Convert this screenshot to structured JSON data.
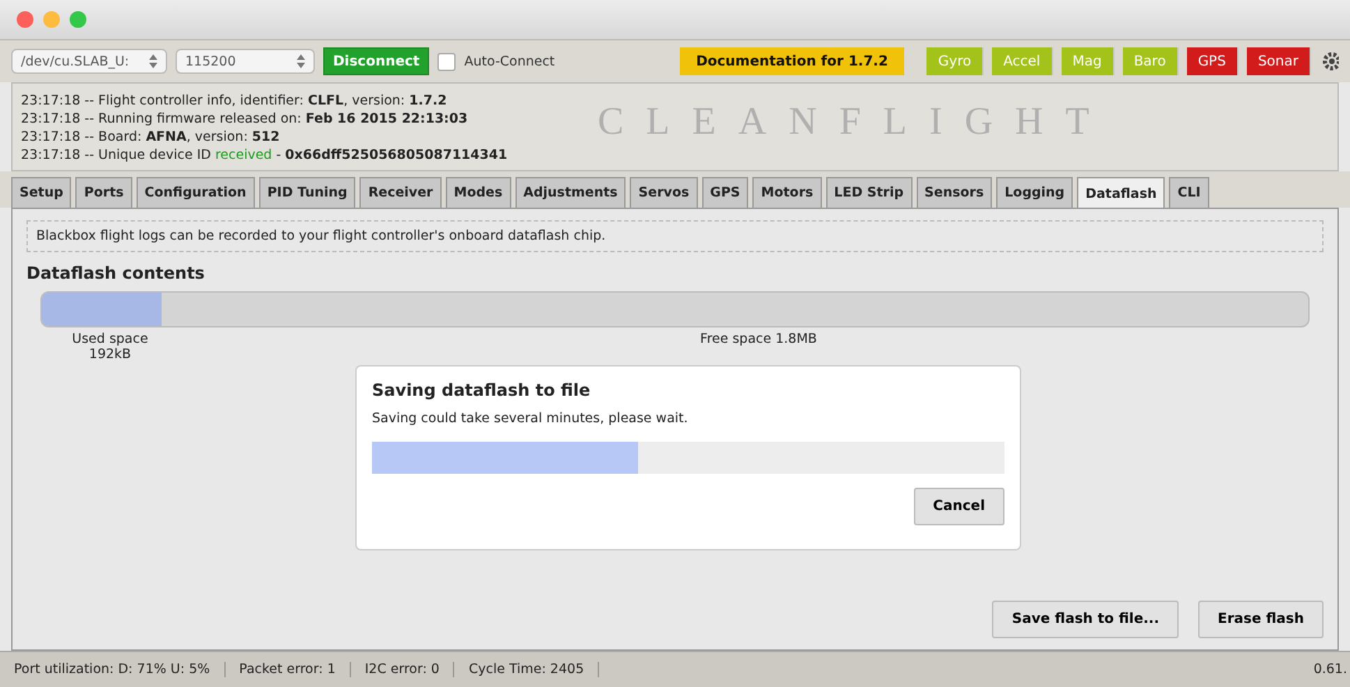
{
  "toolbar": {
    "port": {
      "value": "/dev/cu.SLAB_U:"
    },
    "baud": {
      "value": "115200"
    },
    "connect_button": "Disconnect",
    "auto_connect": {
      "label": "Auto-Connect",
      "checked": false
    },
    "docs_button": "Documentation for 1.7.2",
    "sensors": [
      {
        "label": "Gyro",
        "color": "#a3c21a"
      },
      {
        "label": "Accel",
        "color": "#a3c21a"
      },
      {
        "label": "Mag",
        "color": "#a3c21a"
      },
      {
        "label": "Baro",
        "color": "#a3c21a"
      },
      {
        "label": "GPS",
        "color": "#d21b1b"
      },
      {
        "label": "Sonar",
        "color": "#d21b1b"
      }
    ]
  },
  "log": {
    "logo_text": "CLEANFLIGHT",
    "lines": [
      [
        {
          "kind": "plain",
          "text": "23:17:18 -- Flight controller info, identifier: "
        },
        {
          "kind": "bold",
          "text": "CLFL"
        },
        {
          "kind": "plain",
          "text": ", version: "
        },
        {
          "kind": "bold",
          "text": "1.7.2"
        }
      ],
      [
        {
          "kind": "plain",
          "text": "23:17:18 -- Running firmware released on: "
        },
        {
          "kind": "bold",
          "text": "Feb 16 2015 22:13:03"
        }
      ],
      [
        {
          "kind": "plain",
          "text": "23:17:18 -- Board: "
        },
        {
          "kind": "bold",
          "text": "AFNA"
        },
        {
          "kind": "plain",
          "text": ", version: "
        },
        {
          "kind": "bold",
          "text": "512"
        }
      ],
      [
        {
          "kind": "plain",
          "text": "23:17:18 -- Unique device ID "
        },
        {
          "kind": "ok",
          "text": "received"
        },
        {
          "kind": "plain",
          "text": " - "
        },
        {
          "kind": "bold",
          "text": "0x66dff525056805087114341"
        }
      ]
    ]
  },
  "tabs": [
    {
      "label": "Setup",
      "selected": false
    },
    {
      "label": "Ports",
      "selected": false
    },
    {
      "label": "Configuration",
      "selected": false
    },
    {
      "label": "PID Tuning",
      "selected": false
    },
    {
      "label": "Receiver",
      "selected": false
    },
    {
      "label": "Modes",
      "selected": false
    },
    {
      "label": "Adjustments",
      "selected": false
    },
    {
      "label": "Servos",
      "selected": false
    },
    {
      "label": "GPS",
      "selected": false
    },
    {
      "label": "Motors",
      "selected": false
    },
    {
      "label": "LED Strip",
      "selected": false
    },
    {
      "label": "Sensors",
      "selected": false
    },
    {
      "label": "Logging",
      "selected": false
    },
    {
      "label": "Dataflash",
      "selected": true
    },
    {
      "label": "CLI",
      "selected": false
    }
  ],
  "dataflash": {
    "note": "Blackbox flight logs can be recorded to your flight controller's onboard dataflash chip.",
    "heading": "Dataflash contents",
    "usage": {
      "level": 0.095,
      "used_label": "Used space",
      "used_value": "192kB",
      "free_label": "Free space 1.8MB"
    },
    "buttons": [
      "Save flash to file...",
      "Erase flash"
    ]
  },
  "dialog": {
    "title": "Saving dataflash to file",
    "message": "Saving could take several minutes, please wait.",
    "progress": {
      "level": 0.42
    },
    "button": "Cancel"
  },
  "status_bar": {
    "items": [
      "Port utilization: D: 71% U: 5%",
      "Packet error: 1",
      "I2C error: 0",
      "Cycle Time: 2405"
    ],
    "version": "0.61."
  }
}
